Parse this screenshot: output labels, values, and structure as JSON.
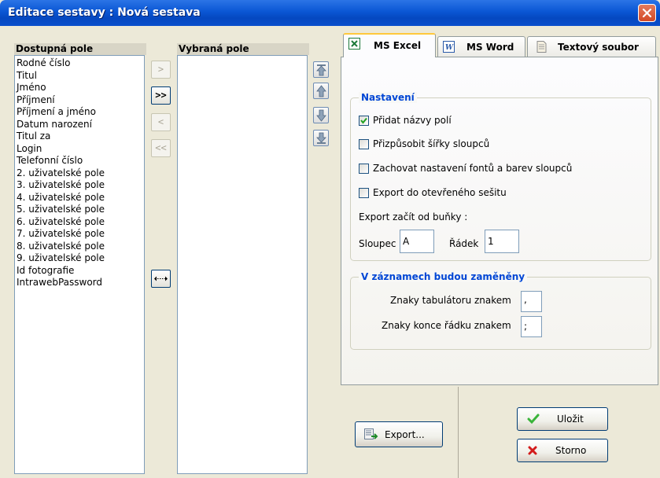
{
  "window": {
    "title": "Editace sestavy : Nová sestava"
  },
  "left": {
    "available_header": "Dostupná pole",
    "available_items": [
      "Rodné číslo",
      "Titul",
      "Jméno",
      "Příjmení",
      "Příjmení a jméno",
      "Datum narození",
      "Titul za",
      "Login",
      "Telefonní číslo",
      "2. uživatelské pole",
      "3. uživatelské pole",
      "4. uživatelské pole",
      "5. uživatelské pole",
      "6. uživatelské pole",
      "7. uživatelské pole",
      "8. uživatelské pole",
      "9. uživatelské pole",
      "Id fotografie",
      "IntrawebPassword"
    ],
    "selected_header": "Vybraná pole",
    "selected_items": []
  },
  "move_buttons": {
    "add": ">",
    "add_all": ">>",
    "remove": "<",
    "remove_all": "<<"
  },
  "tabs": [
    {
      "label": "MS Excel",
      "icon": "excel-icon",
      "active": true
    },
    {
      "label": "MS Word",
      "icon": "word-icon",
      "active": false
    },
    {
      "label": "Textový soubor",
      "icon": "text-file-icon",
      "active": false
    }
  ],
  "settings": {
    "title": "Nastavení",
    "add_field_names": {
      "label": "Přidat názvy polí",
      "checked": true
    },
    "fit_column_widths": {
      "label": "Přizpůsobit šířky sloupců",
      "checked": false
    },
    "keep_fonts": {
      "label": "Zachovat nastavení fontů a barev sloupců",
      "checked": false
    },
    "export_open_workbook": {
      "label": "Export do otevřeného sešitu",
      "checked": false
    },
    "start_cell_label": "Export začít od buňky :",
    "column_label": "Sloupec",
    "column_value": "A",
    "row_label": "Řádek",
    "row_value": "1"
  },
  "replace": {
    "title": "V záznamech budou zaměněny",
    "tab_label": "Znaky tabulátoru znakem",
    "tab_value": ",",
    "newline_label": "Znaky konce řádku znakem",
    "newline_value": ";"
  },
  "buttons": {
    "export": "Export...",
    "save": "Uložit",
    "cancel": "Storno"
  },
  "colors": {
    "title_bar": "#0a56d4",
    "group_title": "#0046d5",
    "window_bg": "#ece9d8"
  }
}
